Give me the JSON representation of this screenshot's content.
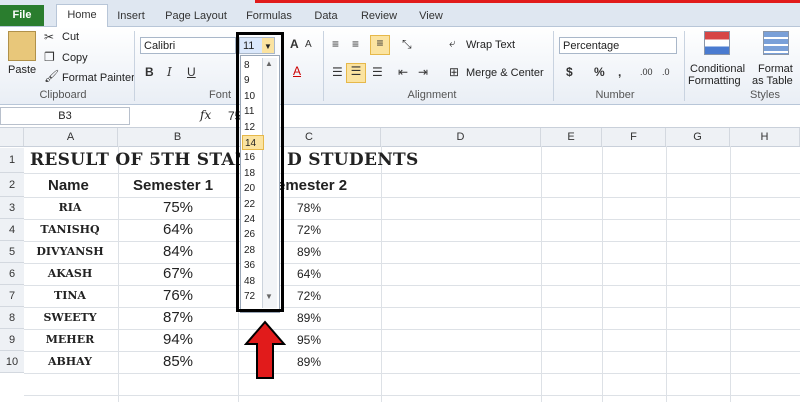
{
  "tabs": [
    "File",
    "Home",
    "Insert",
    "Page Layout",
    "Formulas",
    "Data",
    "Review",
    "View"
  ],
  "clipboard": {
    "paste": "Paste",
    "cut": "Cut",
    "copy": "Copy",
    "format_painter": "Format Painter",
    "label": "Clipboard"
  },
  "font": {
    "name": "Calibri",
    "size": "11",
    "label": "Font",
    "bold": "B",
    "italic": "I",
    "underline": "U",
    "grow": "A",
    "shrink": "A"
  },
  "alignment": {
    "wrap": "Wrap Text",
    "merge": "Merge & Center",
    "label": "Alignment"
  },
  "number": {
    "format": "Percentage",
    "currency": "$",
    "percent": "%",
    "comma": ",",
    "inc_dec": ".00",
    "dec_dec": ".0",
    "label": "Number"
  },
  "styles": {
    "conditional": "Conditional",
    "formatting": "Formatting",
    "format": "Format",
    "as_table": "as Table",
    "label": "Styles"
  },
  "formula_bar": {
    "name_box": "B3",
    "fx": "fx",
    "value": "75"
  },
  "columns": [
    "A",
    "B",
    "C",
    "D",
    "E",
    "F",
    "G",
    "H"
  ],
  "rows": [
    "1",
    "2",
    "3",
    "4",
    "5",
    "6",
    "7",
    "8",
    "9",
    "10"
  ],
  "sheet": {
    "title": "RESULT OF 5TH STAN",
    "title_tail": "D STUDENTS",
    "header_name": "Name",
    "header_s1": "Semester 1",
    "header_s2": "emester 2",
    "students": [
      {
        "name": "RIA",
        "s1": "75%",
        "s2": "78%"
      },
      {
        "name": "TANISHQ",
        "s1": "64%",
        "s2": "72%"
      },
      {
        "name": "DIVYANSH",
        "s1": "84%",
        "s2": "89%"
      },
      {
        "name": "AKASH",
        "s1": "67%",
        "s2": "64%"
      },
      {
        "name": "TINA",
        "s1": "76%",
        "s2": "72%"
      },
      {
        "name": "SWEETY",
        "s1": "87%",
        "s2": "89%"
      },
      {
        "name": "MEHER",
        "s1": "94%",
        "s2": "95%"
      },
      {
        "name": "ABHAY",
        "s1": "85%",
        "s2": "89%"
      }
    ]
  },
  "font_size_options": [
    "8",
    "9",
    "10",
    "11",
    "12",
    "14",
    "16",
    "18",
    "20",
    "22",
    "24",
    "26",
    "28",
    "36",
    "48",
    "72"
  ],
  "selected_size": "14",
  "colors": {
    "file_tab": "#2a7d2e",
    "highlight": "#000000",
    "arrow": "#e11b1b",
    "selected_option": "#fbe3a0"
  }
}
